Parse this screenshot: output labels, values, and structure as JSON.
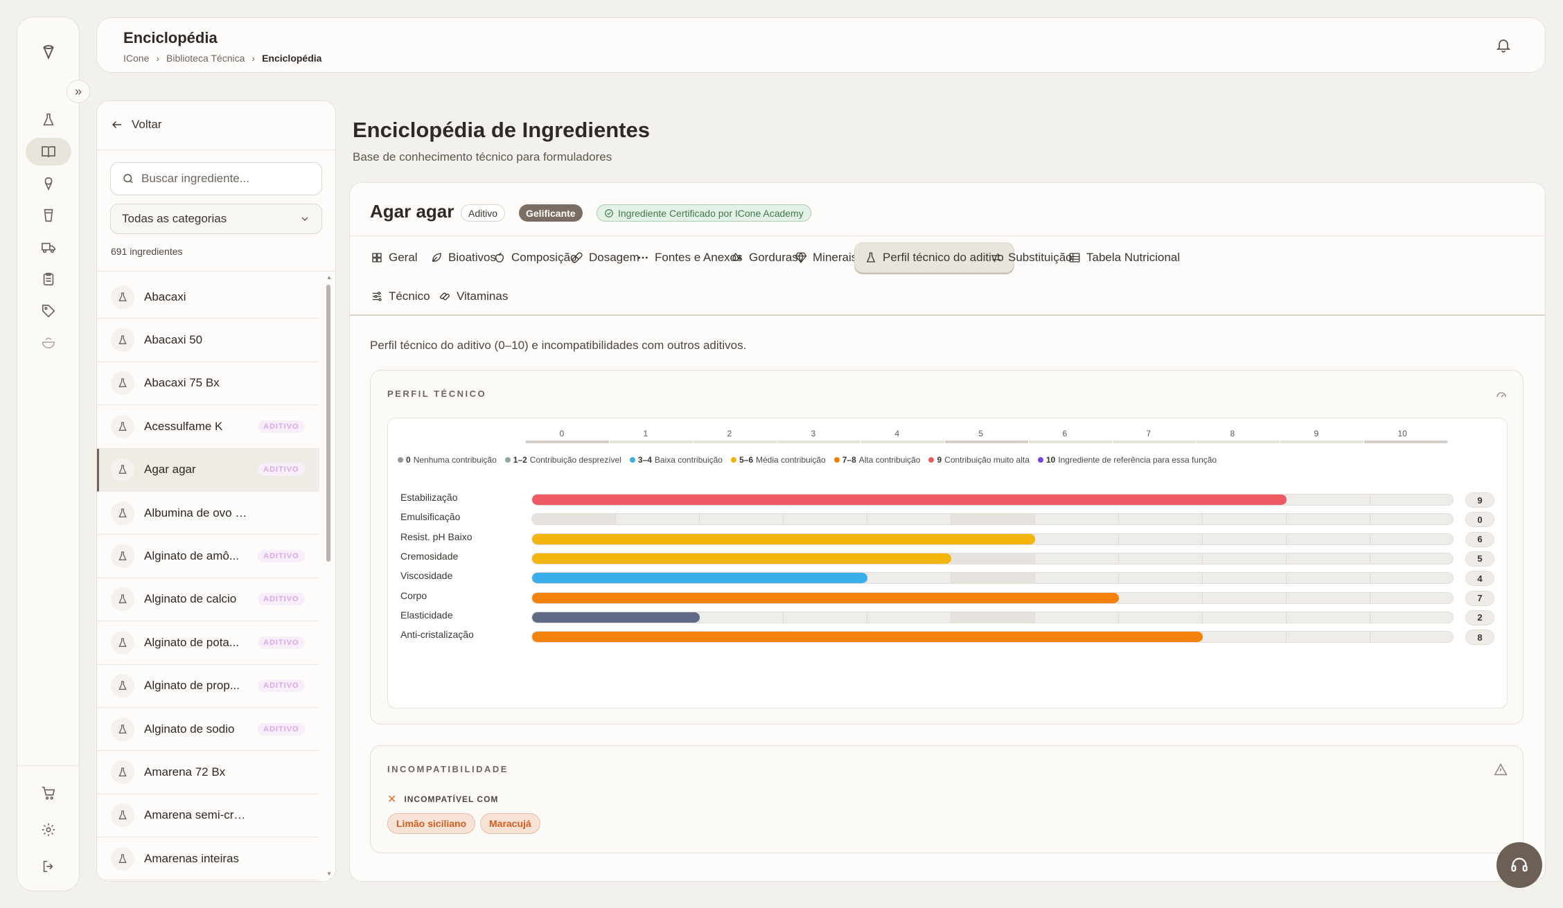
{
  "header": {
    "title": "Enciclopédia",
    "breadcrumbs": [
      "ICone",
      "Biblioteca Técnica",
      "Enciclopédia"
    ]
  },
  "sidebar": {
    "icons": [
      "logo-icon",
      "flask-icon",
      "book-icon",
      "ice-cream-icon",
      "cup-icon",
      "truck-icon",
      "clipboard-icon",
      "tag-icon",
      "bowl-icon",
      "cart-icon",
      "gear-icon",
      "logout-icon"
    ],
    "active_index": 2
  },
  "list_panel": {
    "back_label": "Voltar",
    "search_placeholder": "Buscar ingrediente...",
    "category_value": "Todas as categorias",
    "count_text": "691 ingredientes",
    "items": [
      {
        "name": "Abacaxi",
        "badge": ""
      },
      {
        "name": "Abacaxi 50",
        "badge": ""
      },
      {
        "name": "Abacaxi 75 Bx",
        "badge": ""
      },
      {
        "name": "Acessulfame K",
        "badge": "ADITIVO"
      },
      {
        "name": "Agar agar",
        "badge": "ADITIVO"
      },
      {
        "name": "Albumina de ovo desidratada",
        "badge": ""
      },
      {
        "name": "Alginato de amô...",
        "badge": "ADITIVO"
      },
      {
        "name": "Alginato de calcio",
        "badge": "ADITIVO"
      },
      {
        "name": "Alginato de pota...",
        "badge": "ADITIVO"
      },
      {
        "name": "Alginato de prop...",
        "badge": "ADITIVO"
      },
      {
        "name": "Alginato de sodio",
        "badge": "ADITIVO"
      },
      {
        "name": "Amarena 72 Bx",
        "badge": ""
      },
      {
        "name": "Amarena semi-cristalizada",
        "badge": ""
      },
      {
        "name": "Amarenas inteiras",
        "badge": ""
      }
    ],
    "selected_index": 4
  },
  "main": {
    "title": "Enciclopédia de Ingredientes",
    "subtitle": "Base de conhecimento técnico para formuladores",
    "ingredient": {
      "name": "Agar agar",
      "tags": [
        "Aditivo",
        "Gelificante",
        "Ingrediente Certificado por ICone Academy"
      ]
    },
    "tabs": [
      {
        "label": "Geral",
        "icon": "grid-icon"
      },
      {
        "label": "Bioativos",
        "icon": "leaf-icon"
      },
      {
        "label": "Composição",
        "icon": "apple-icon"
      },
      {
        "label": "Dosagem",
        "icon": "pill-icon"
      },
      {
        "label": "Fontes e Anexos",
        "icon": "dots-icon"
      },
      {
        "label": "Gorduras",
        "icon": "drops-icon"
      },
      {
        "label": "Minerais",
        "icon": "gem-icon"
      },
      {
        "label": "Perfil técnico do aditivo",
        "icon": "flask-icon"
      },
      {
        "label": "Substituição",
        "icon": "swap-icon"
      },
      {
        "label": "Tabela Nutricional",
        "icon": "table-icon"
      },
      {
        "label": "Técnico",
        "icon": "sliders-icon"
      },
      {
        "label": "Vitaminas",
        "icon": "capsule-icon"
      }
    ],
    "active_tab": 7,
    "description": "Perfil técnico do aditivo (0–10) e incompatibilidades com outros aditivos.",
    "profile_title": "PERFIL TÉCNICO",
    "incompat_title": "INCOMPATIBILIDADE",
    "incompat_heading": "INCOMPATÍVEL COM",
    "incompat_items": [
      "Limão siciliano",
      "Maracujá"
    ]
  },
  "chart_data": {
    "type": "bar",
    "orientation": "horizontal",
    "xlim": [
      0,
      10
    ],
    "scale_labels": [
      "0",
      "1",
      "2",
      "3",
      "4",
      "5",
      "6",
      "7",
      "8",
      "9",
      "10"
    ],
    "legend": [
      {
        "n": "0",
        "label": "Nenhuma contribuição",
        "color": "#9a958d"
      },
      {
        "n": "1–2",
        "label": "Contribuição desprezível",
        "color": "#8fa89a"
      },
      {
        "n": "3–4",
        "label": "Baixa contribuição",
        "color": "#3aaee8"
      },
      {
        "n": "5–6",
        "label": "Média contribuição",
        "color": "#f2b50c"
      },
      {
        "n": "7–8",
        "label": "Alta contribuição",
        "color": "#f5820a"
      },
      {
        "n": "9",
        "label": "Contribuição muito alta",
        "color": "#ee5a64"
      },
      {
        "n": "10",
        "label": "Ingrediente de referência para essa função",
        "color": "#7b3fe0"
      }
    ],
    "categories": [
      "Estabilização",
      "Emulsificação",
      "Resist. pH Baixo",
      "Cremosidade",
      "Viscosidade",
      "Corpo",
      "Elasticidade",
      "Anti-cristalização"
    ],
    "values": [
      9,
      0,
      6,
      5,
      4,
      7,
      2,
      8
    ],
    "colors": [
      "#ee5a64",
      "#cfcbc4",
      "#f2b50c",
      "#f2b50c",
      "#3aaee8",
      "#f5820a",
      "#5f6b86",
      "#f5820a"
    ]
  }
}
